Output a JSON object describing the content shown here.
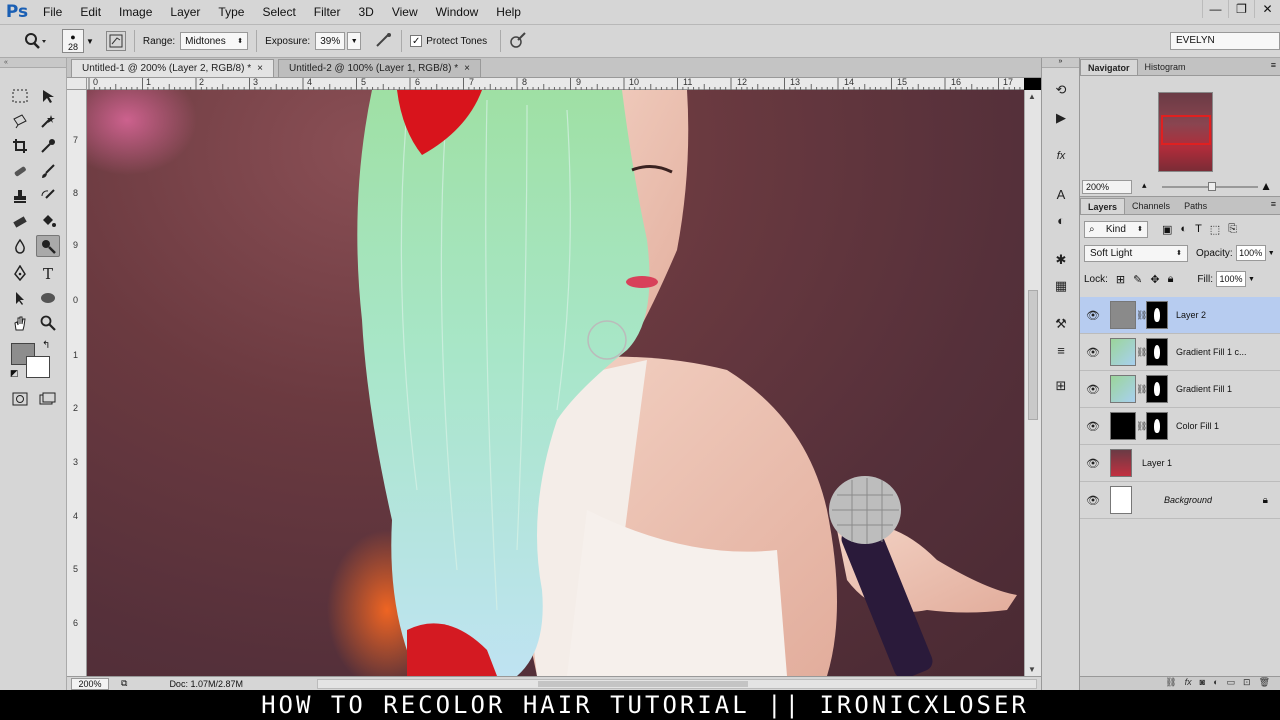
{
  "app": {
    "logo": "Ps"
  },
  "menu": [
    "File",
    "Edit",
    "Image",
    "Layer",
    "Type",
    "Select",
    "Filter",
    "3D",
    "View",
    "Window",
    "Help"
  ],
  "window_controls": [
    "—",
    "❐",
    "✕"
  ],
  "options": {
    "brush_size": "28",
    "range_label": "Range:",
    "range_value": "Midtones",
    "exposure_label": "Exposure:",
    "exposure_value": "39%",
    "protect_tones_label": "Protect Tones",
    "protect_tones_checked": true,
    "workspace": "EVELYN"
  },
  "tabs": [
    {
      "label": "Untitled-1 @ 200% (Layer 2, RGB/8) *",
      "active": true
    },
    {
      "label": "Untitled-2 @ 100% (Layer 1, RGB/8) *",
      "active": false
    }
  ],
  "ruler_top": [
    "0",
    "1",
    "2",
    "3",
    "4",
    "5",
    "6",
    "7",
    "8",
    "9",
    "10",
    "11",
    "12",
    "13",
    "14",
    "15",
    "16",
    "17"
  ],
  "ruler_left": [
    "7",
    "8",
    "9",
    "0",
    "1",
    "2",
    "3",
    "4",
    "5",
    "6"
  ],
  "status": {
    "zoom": "200%",
    "doc": "Doc: 1.07M/2.87M"
  },
  "navigator": {
    "tabs": [
      "Navigator",
      "Histogram"
    ],
    "zoom": "200%"
  },
  "layers": {
    "tabs": [
      "Layers",
      "Channels",
      "Paths"
    ],
    "kind_label": "Kind",
    "blend_mode": "Soft Light",
    "opacity_label": "Opacity:",
    "opacity": "100%",
    "lock_label": "Lock:",
    "fill_label": "Fill:",
    "fill": "100%",
    "items": [
      {
        "name": "Layer 2",
        "selected": true,
        "italic": false
      },
      {
        "name": "Gradient Fill 1 c...",
        "selected": false,
        "italic": false
      },
      {
        "name": "Gradient Fill 1",
        "selected": false,
        "italic": false
      },
      {
        "name": "Color Fill 1",
        "selected": false,
        "italic": false
      },
      {
        "name": "Layer 1",
        "selected": false,
        "italic": false
      },
      {
        "name": "Background",
        "selected": false,
        "italic": true
      }
    ]
  },
  "caption": "HOW TO RECOLOR HAIR TUTORIAL || IRONICXLOSER",
  "colors": {
    "selection": "#b7ccf0",
    "chrome": "#d6d6d6",
    "ps_blue": "#1a5fb4"
  }
}
